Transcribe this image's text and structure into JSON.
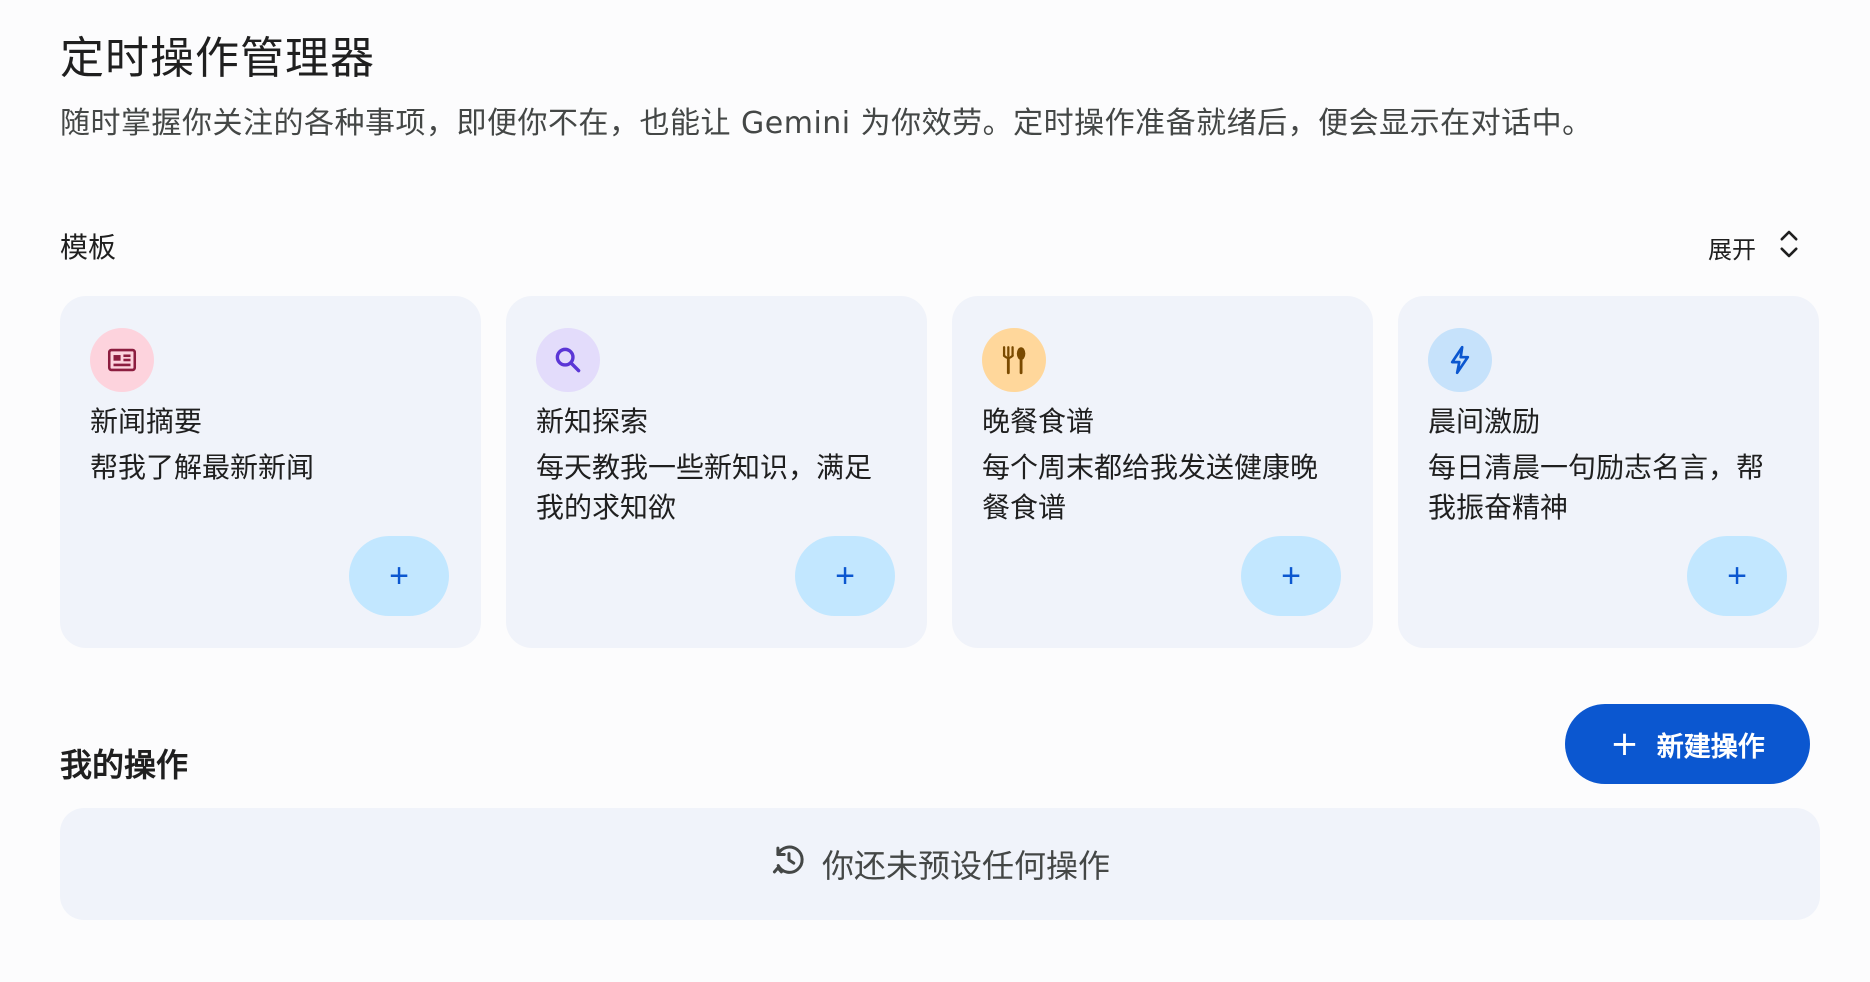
{
  "header": {
    "title": "定时操作管理器",
    "subtitle": "随时掌握你关注的各种事项，即便你不在，也能让 Gemini 为你效劳。定时操作准备就绪后，便会显示在对话中。"
  },
  "templates": {
    "label": "模板",
    "expand_label": "展开",
    "cards": [
      {
        "title": "新闻摘要",
        "description": "帮我了解最新新闻",
        "icon": "news-icon",
        "icon_bg": "#fdd3dd",
        "icon_color": "#8c1d3f",
        "add_label": "+"
      },
      {
        "title": "新知探索",
        "description": "每天教我一些新知识，满足我的求知欲",
        "icon": "search-icon",
        "icon_bg": "#e3dcfb",
        "icon_color": "#5b36d6",
        "add_label": "+"
      },
      {
        "title": "晚餐食谱",
        "description": "每个周末都给我发送健康晚餐食谱",
        "icon": "restaurant-icon",
        "icon_bg": "#ffd79b",
        "icon_color": "#7a4a00",
        "add_label": "+"
      },
      {
        "title": "晨间激励",
        "description": "每日清晨一句励志名言，帮我振奋精神",
        "icon": "bolt-icon",
        "icon_bg": "#c6e2fb",
        "icon_color": "#0b57d0",
        "add_label": "+"
      }
    ]
  },
  "my_actions": {
    "label": "我的操作",
    "new_button_plus": "+",
    "new_button_label": "新建操作",
    "empty_text": "你还未预设任何操作"
  },
  "colors": {
    "accent": "#0b57d0",
    "card_bg": "#f0f3fa",
    "add_button_bg": "#c2e7ff"
  }
}
